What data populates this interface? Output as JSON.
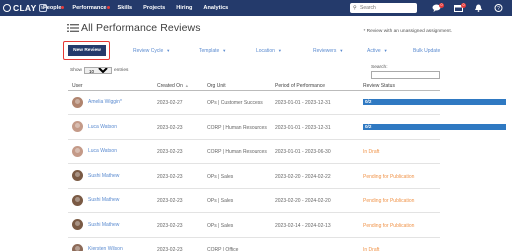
{
  "nav": {
    "brand": "CLAY",
    "edition": "hr",
    "items": [
      "People",
      "Performance",
      "Skills",
      "Projects",
      "Hiring",
      "Analytics"
    ],
    "search_placeholder": "Search",
    "badges": {
      "messages": "0",
      "tasks": "0"
    },
    "colors": {
      "bar": "#243a6b",
      "badge": "#e53b3b"
    }
  },
  "page": {
    "title": "All Performance Reviews",
    "note": "* Review with an unassigned assignment."
  },
  "toolbar": {
    "new_review": "New Review",
    "filters": [
      "Review Cycle",
      "Template",
      "Location",
      "Reviewers",
      "Active"
    ],
    "bulk_update": "Bulk Update"
  },
  "table_controls": {
    "show_label": "Show",
    "entries_value": "10",
    "entries_label": "entries",
    "search_label": "Search:"
  },
  "table": {
    "headers": [
      "User",
      "Created On",
      "Org Unit",
      "Period of Performance",
      "Review Status"
    ],
    "rows": [
      {
        "user": "Amelia Wiggin*",
        "created": "2023-02-27",
        "org": "OPs | Customer Success",
        "period": "2023-01-01 - 2023-12-31",
        "status": "0/2",
        "status_type": "progress",
        "progress": 1.0,
        "avatar_color": "#b0846e"
      },
      {
        "user": "Luca Watson",
        "created": "2023-02-23",
        "org": "CORP | Human Resources",
        "period": "2023-01-01 - 2023-12-31",
        "status": "0/2",
        "status_type": "progress",
        "progress": 1.0,
        "avatar_color": "#c49a88"
      },
      {
        "user": "Luca Watson",
        "created": "2023-02-23",
        "org": "CORP | Human Resources",
        "period": "2023-01-01 - 2023-06-30",
        "status": "In Draft",
        "status_type": "text",
        "avatar_color": "#c49a88"
      },
      {
        "user": "Sushi Mathew",
        "created": "2023-02-23",
        "org": "OPs | Sales",
        "period": "2023-02-20 - 2024-02-22",
        "status": "Pending for Publication",
        "status_type": "text",
        "avatar_color": "#7a5a44"
      },
      {
        "user": "Sushi Mathew",
        "created": "2023-02-23",
        "org": "OPs | Sales",
        "period": "2023-02-20 - 2024-02-20",
        "status": "Pending for Publication",
        "status_type": "text",
        "avatar_color": "#7a5a44"
      },
      {
        "user": "Sushi Mathew",
        "created": "2023-02-23",
        "org": "OPs | Sales",
        "period": "2023-02-14 - 2024-02-13",
        "status": "Pending for Publication",
        "status_type": "text",
        "avatar_color": "#7a5a44"
      },
      {
        "user": "Kiersten Wilson",
        "created": "2023-02-23",
        "org": "CORP | Office",
        "period": "",
        "status": "In Draft",
        "status_type": "text",
        "avatar_color": "#8c6a58"
      }
    ],
    "colors": {
      "link": "#5b8bd0",
      "progress": "#2f79c2",
      "pending": "#f0944a"
    }
  }
}
